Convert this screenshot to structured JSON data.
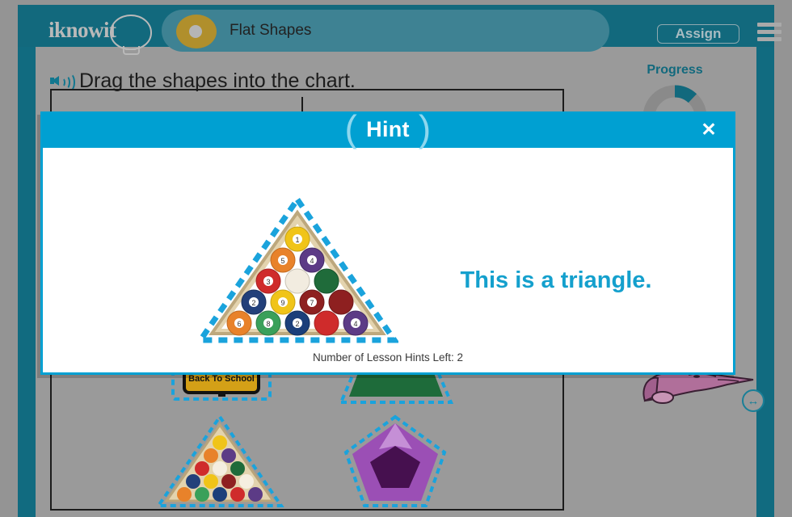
{
  "app": {
    "logo_text": "iknowit",
    "logo_icon": "lightbulb-icon"
  },
  "header": {
    "lesson_title": "Flat Shapes",
    "assign_label": "Assign",
    "menu_icon": "hamburger-menu-icon",
    "lesson_dot_icon": "lesson-marker-icon"
  },
  "lesson": {
    "prompt": "Drag the shapes into the chart.",
    "audio_icon": "speaker-icon",
    "progress_label": "Progress",
    "progress_percent": 12,
    "progress_track_color": "#8a8a8a",
    "progress_fill_color": "#12697d",
    "resize_icon": "resize-horizontal-icon",
    "mascot_icon": "dinosaur-mascot-icon",
    "shapes": [
      {
        "name": "back-to-school-sign",
        "label": "Back To School",
        "shape": "square",
        "color": "#d4a017"
      },
      {
        "name": "green-trapezoid",
        "label": "",
        "shape": "trapezoid",
        "color": "#1e6b3a"
      },
      {
        "name": "billiards-triangle",
        "label": "",
        "shape": "triangle",
        "color": "#d9c49a"
      },
      {
        "name": "amethyst-pentagon",
        "label": "",
        "shape": "pentagon",
        "color": "#9b4fb5"
      }
    ]
  },
  "hint_modal": {
    "title": "Hint",
    "paren_left": "(",
    "paren_right": ")",
    "close_icon": "close-icon",
    "message": "This is a triangle.",
    "footer": "Number of Lesson Hints Left: 2",
    "image_name": "billiards-rack-triangle-image",
    "header_color": "#00a0d2",
    "text_color": "#14a0cd"
  }
}
